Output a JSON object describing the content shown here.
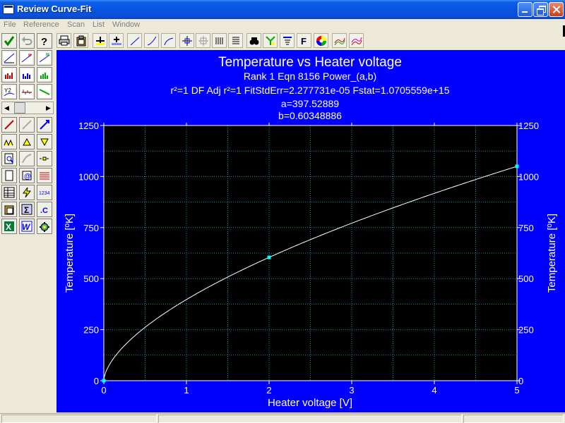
{
  "window": {
    "title": "Review Curve-Fit"
  },
  "menu": {
    "items": [
      "File",
      "Reference",
      "Scan",
      "List",
      "Window"
    ]
  },
  "toolbar": {
    "icons": [
      "print-icon",
      "clipboard-icon",
      "add-point-icon",
      "add-points-icon",
      "linear-fit-icon",
      "curve-fit-icon",
      "smooth-fit-icon",
      "zoom-cursor-icon",
      "grid-cursor-icon",
      "vertical-lines-icon",
      "horizontal-lines-icon",
      "binoculars-icon",
      "graph-select-icon",
      "scale-icon",
      "font-icon",
      "color-wheel-icon",
      "wave-icon",
      "multi-wave-icon"
    ]
  },
  "leftpanel": {
    "icons": [
      "check-icon",
      "undo-icon",
      "help-icon",
      "fit-list-icon-1",
      "fit-list-icon-2",
      "fit-list-icon-3",
      "bar-fit-icon-1",
      "bar-fit-icon-2",
      "bar-fit-icon-3",
      "y2-icon",
      "residual-icon",
      "diagonal-icon",
      "line-icon",
      "feather-icon",
      "axis-icon",
      "peaks-icon",
      "peak-icon",
      "valley-icon",
      "zoom-doc-icon",
      "curve-icon",
      "dash-icon",
      "blank-page-icon",
      "at-icon",
      "lines-icon",
      "table-icon",
      "lightning-icon",
      "numbers-icon",
      "paste-icon",
      "sigma-icon",
      "c-icon",
      "excel-icon",
      "word-icon",
      "gear-icon"
    ]
  },
  "chart_data": {
    "type": "line",
    "title": "Temperature vs Heater voltage",
    "subtitle_lines": [
      "Rank 1  Eqn 8156  Power_(a,b)",
      "r²=1  DF Adj r²=1  FitStdErr=2.277731e-05  Fstat=1.0705559e+15",
      "a=397.52889",
      "b=0.60348886"
    ],
    "xlabel": "Heater voltage [V]",
    "ylabel": "Temperature [ºK]",
    "y2label": "Temperature [ºK]",
    "xlim": [
      0,
      5
    ],
    "ylim": [
      0,
      1250
    ],
    "xticks": [
      "0",
      "1",
      "2",
      "3",
      "4",
      "5"
    ],
    "yticks": [
      "0",
      "250",
      "500",
      "750",
      "1000",
      "1250"
    ],
    "grid": true,
    "background": "#000000",
    "frame_color": "#0000ff",
    "curve_color": "#ffffff",
    "point_color": "#00ffff",
    "fit": {
      "equation": "y = a*x^b",
      "a": 397.52889,
      "b": 0.60348886
    },
    "points": [
      {
        "x": 0,
        "y": 0
      },
      {
        "x": 2,
        "y": 604
      },
      {
        "x": 5,
        "y": 1050
      }
    ]
  }
}
